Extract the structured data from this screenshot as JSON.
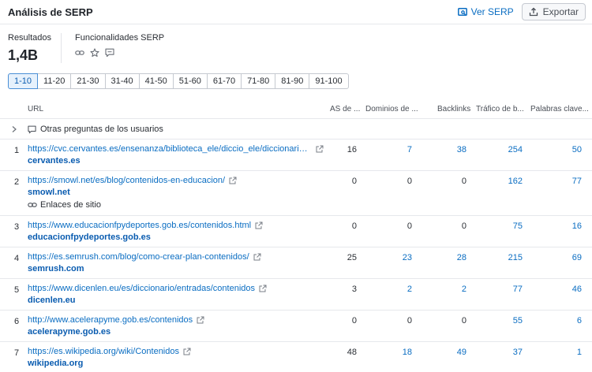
{
  "header": {
    "title": "Análisis de SERP",
    "view_serp_label": "Ver SERP",
    "export_label": "Exportar"
  },
  "stats": {
    "results_label": "Resultados",
    "results_value": "1,4B",
    "features_label": "Funcionalidades SERP",
    "feature_icons": [
      "link-icon",
      "star-icon",
      "comment-icon"
    ]
  },
  "pager": {
    "pages": [
      "1-10",
      "11-20",
      "21-30",
      "31-40",
      "41-50",
      "51-60",
      "61-70",
      "71-80",
      "81-90",
      "91-100"
    ],
    "active": "1-10"
  },
  "table": {
    "headers": {
      "url": "URL",
      "as": "AS de ...",
      "domains": "Dominios de ...",
      "backlinks": "Backlinks",
      "traffic": "Tráfico de b...",
      "keywords": "Palabras clave..."
    },
    "qa_row_label": "Otras preguntas de los usuarios",
    "sitelinks_label": "Enlaces de sitio",
    "rows": [
      {
        "n": "1",
        "url": "https://cvc.cervantes.es/ensenanza/biblioteca_ele/diccio_ele/diccionario/co...",
        "domain": "cervantes.es",
        "as": "16",
        "domains": "7",
        "backlinks": "38",
        "traffic": "254",
        "keywords": "50"
      },
      {
        "n": "2",
        "url": "https://smowl.net/es/blog/contenidos-en-educacion/",
        "domain": "smowl.net",
        "as": "0",
        "domains": "0",
        "backlinks": "0",
        "traffic": "162",
        "keywords": "77"
      },
      {
        "n": "3",
        "url": "https://www.educacionfpydeportes.gob.es/contenidos.html",
        "domain": "educacionfpydeportes.gob.es",
        "as": "0",
        "domains": "0",
        "backlinks": "0",
        "traffic": "75",
        "keywords": "16"
      },
      {
        "n": "4",
        "url": "https://es.semrush.com/blog/como-crear-plan-contenidos/",
        "domain": "semrush.com",
        "as": "25",
        "domains": "23",
        "backlinks": "28",
        "traffic": "215",
        "keywords": "69"
      },
      {
        "n": "5",
        "url": "https://www.dicenlen.eu/es/diccionario/entradas/contenidos",
        "domain": "dicenlen.eu",
        "as": "3",
        "domains": "2",
        "backlinks": "2",
        "traffic": "77",
        "keywords": "46"
      },
      {
        "n": "6",
        "url": "http://www.acelerapyme.gob.es/contenidos",
        "domain": "acelerapyme.gob.es",
        "as": "0",
        "domains": "0",
        "backlinks": "0",
        "traffic": "55",
        "keywords": "6"
      },
      {
        "n": "7",
        "url": "https://es.wikipedia.org/wiki/Contenidos",
        "domain": "wikipedia.org",
        "as": "48",
        "domains": "18",
        "backlinks": "49",
        "traffic": "37",
        "keywords": "1"
      }
    ]
  },
  "colors": {
    "link": "#0a6dc2",
    "domain": "#0a5cb0",
    "active_page_bg": "#e6f1fc"
  }
}
